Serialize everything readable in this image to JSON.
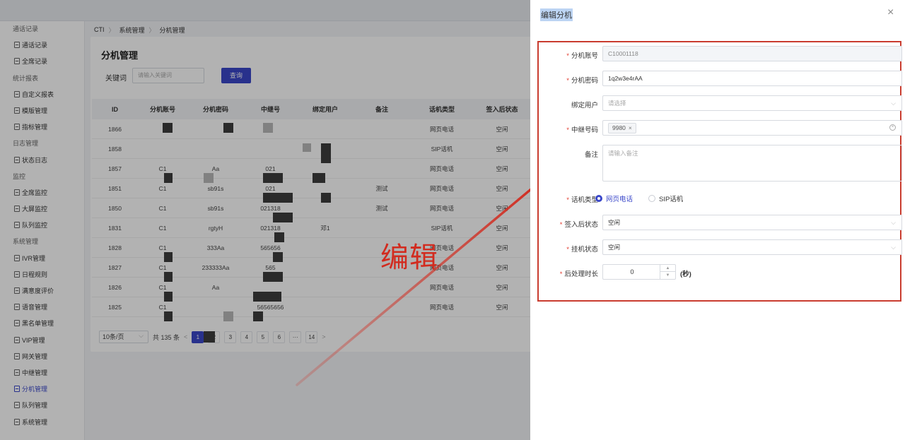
{
  "breadcrumb": [
    "CTI",
    "系统管理",
    "分机管理"
  ],
  "sidebar": [
    {
      "type": "group",
      "label": "通话记录"
    },
    {
      "type": "item",
      "label": "通话记录"
    },
    {
      "type": "item",
      "label": "全席记录"
    },
    {
      "type": "group",
      "label": "统计报表"
    },
    {
      "type": "item",
      "label": "自定义报表"
    },
    {
      "type": "item",
      "label": "模版管理"
    },
    {
      "type": "item",
      "label": "指标管理"
    },
    {
      "type": "group",
      "label": "日志管理"
    },
    {
      "type": "item",
      "label": "状态日志"
    },
    {
      "type": "group",
      "label": "监控"
    },
    {
      "type": "item",
      "label": "全席监控"
    },
    {
      "type": "item",
      "label": "大屏监控"
    },
    {
      "type": "item",
      "label": "队列监控"
    },
    {
      "type": "group",
      "label": "系统管理"
    },
    {
      "type": "item",
      "label": "IVR管理"
    },
    {
      "type": "item",
      "label": "日程规则"
    },
    {
      "type": "item",
      "label": "满意度评价"
    },
    {
      "type": "item",
      "label": "语音管理"
    },
    {
      "type": "item",
      "label": "黑名单管理"
    },
    {
      "type": "item",
      "label": "VIP管理"
    },
    {
      "type": "item",
      "label": "网关管理"
    },
    {
      "type": "item",
      "label": "中继管理"
    },
    {
      "type": "item",
      "label": "分机管理",
      "active": true
    },
    {
      "type": "item",
      "label": "队列管理"
    },
    {
      "type": "item",
      "label": "系统管理"
    }
  ],
  "main": {
    "title": "分机管理",
    "keyword_label": "关键词",
    "keyword_placeholder": "请输入关键词",
    "query_label": "查询",
    "columns": [
      "ID",
      "分机账号",
      "分机密码",
      "中继号",
      "绑定用户",
      "备注",
      "话机类型",
      "签入后状态"
    ],
    "rows": [
      [
        "1866",
        "",
        "",
        "",
        "",
        "",
        "网页电话",
        "空闲"
      ],
      [
        "1858",
        "",
        "",
        "",
        "",
        "",
        "SIP话机",
        "空闲"
      ],
      [
        "1857",
        "C1",
        "Aa",
        "021",
        "",
        "",
        "网页电话",
        "空闲"
      ],
      [
        "1851",
        "C1",
        "sb91s",
        "021",
        "",
        "测试",
        "网页电话",
        "空闲"
      ],
      [
        "1850",
        "C1",
        "sb91s",
        "021318",
        "",
        "测试",
        "网页电话",
        "空闲"
      ],
      [
        "1831",
        "C1",
        "rgtyH",
        "021318",
        "邓1",
        "",
        "SIP话机",
        "空闲"
      ],
      [
        "1828",
        "C1",
        "333Aa",
        "565656",
        "",
        "",
        "网页电话",
        "空闲"
      ],
      [
        "1827",
        "C1",
        "233333Aa",
        "565",
        "",
        "",
        "网页电话",
        "空闲"
      ],
      [
        "1826",
        "C1",
        "Aa",
        "",
        "",
        "",
        "网页电话",
        "空闲"
      ],
      [
        "1825",
        "C1",
        "",
        "56565656",
        "",
        "",
        "网页电话",
        "空闲"
      ]
    ],
    "pager": {
      "size": "10条/页",
      "total": "共 135 条",
      "pages": [
        "1",
        "2",
        "3",
        "4",
        "5",
        "6",
        "···",
        "14"
      ],
      "prev": "<",
      "next": ">"
    }
  },
  "annotation": {
    "text": "编辑",
    "color": "#d22b1f"
  },
  "drawer": {
    "title": "编辑分机",
    "close": "×",
    "fields": {
      "account": {
        "label": "分机账号",
        "value": "C10001118"
      },
      "password": {
        "label": "分机密码",
        "value": "1q2w3e4rAA"
      },
      "bind_user": {
        "label": "绑定用户",
        "placeholder": "请选择"
      },
      "trunk": {
        "label": "中继号码",
        "tag": "9980",
        "tag_close": "×"
      },
      "remark": {
        "label": "备注",
        "placeholder": "请输入备注"
      },
      "phone_type": {
        "label": "话机类型",
        "options": [
          "网页电话",
          "SIP话机"
        ],
        "selected": "网页电话"
      },
      "signin_state": {
        "label": "签入后状态",
        "value": "空闲"
      },
      "hangup_state": {
        "label": "挂机状态",
        "value": "空闲"
      },
      "after_time": {
        "label": "后处理时长",
        "value": "0",
        "unit": "(秒)"
      }
    }
  },
  "colors": {
    "primary": "#3a47c9",
    "annotation_red": "#d22b1f",
    "required": "#e33b2f"
  }
}
